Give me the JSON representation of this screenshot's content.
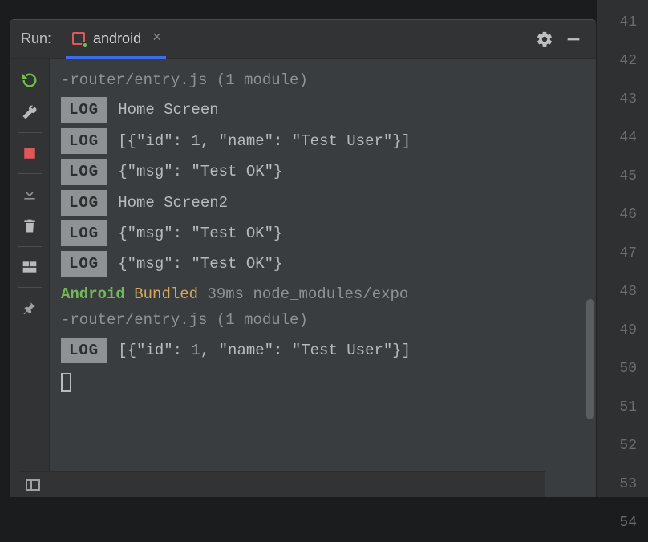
{
  "header": {
    "title": "Run:",
    "tab_label": "android"
  },
  "toolbar": {
    "rerun": "rerun",
    "edit": "edit-configurations",
    "stop": "stop",
    "export": "export",
    "delete": "delete",
    "layout": "layout",
    "pin": "pin"
  },
  "console": {
    "log_badge": "LOG",
    "wrap1": "-router/entry.js (1 module)",
    "lines": {
      "l0": "Home Screen",
      "l1": "[{\"id\": 1, \"name\": \"Test User\"}]",
      "l2": "{\"msg\": \"Test OK\"}",
      "l3": "Home Screen2",
      "l4": "{\"msg\": \"Test OK\"}",
      "l5": "{\"msg\": \"Test OK\"}",
      "l6": "[{\"id\": 1, \"name\": \"Test User\"}]"
    },
    "bundle": {
      "platform": "Android",
      "word": "Bundled",
      "rest": "39ms node_modules/expo",
      "wrap": "-router/entry.js (1 module)"
    }
  },
  "gutter": {
    "n0": "41",
    "n1": "42",
    "n2": "43",
    "n3": "44",
    "n4": "45",
    "n5": "46",
    "n6": "47",
    "n7": "48",
    "n8": "49",
    "n9": "50",
    "n10": "51",
    "n11": "52",
    "n12": "53",
    "n13": "54"
  }
}
